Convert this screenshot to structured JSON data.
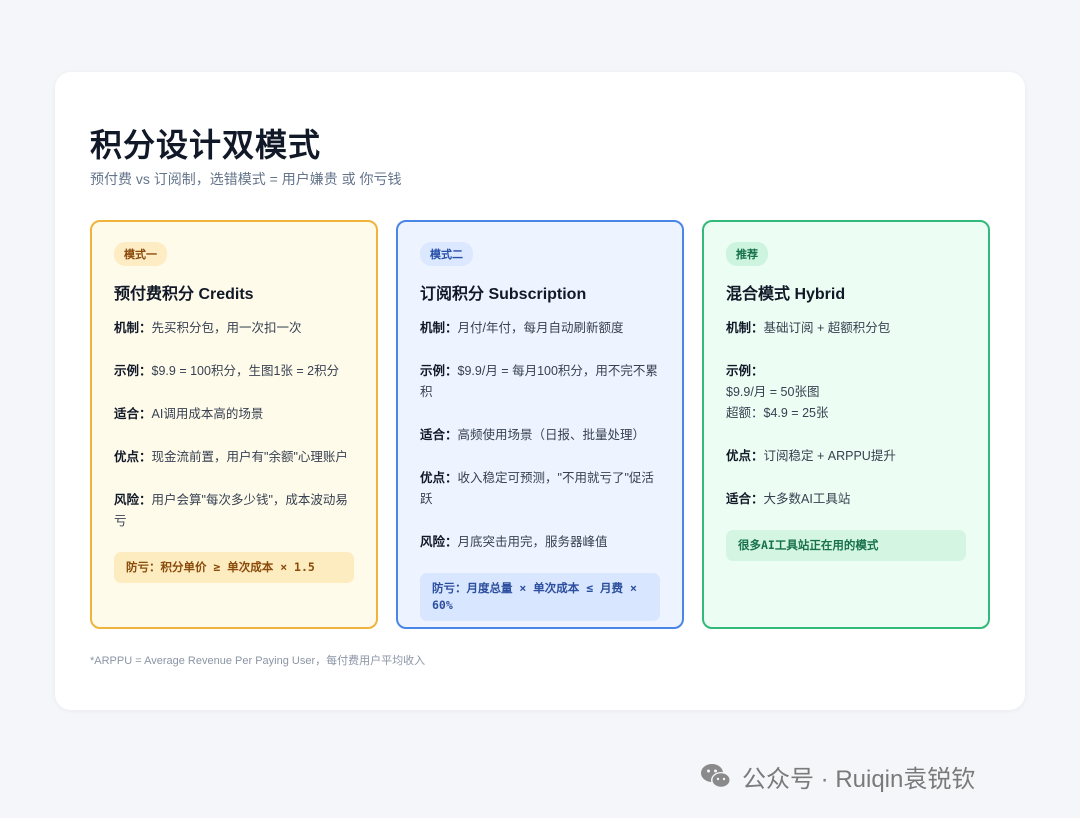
{
  "header": {
    "title": "积分设计双模式",
    "subtitle": "预付费 vs 订阅制，选错模式 = 用户嫌贵 或 你亏钱"
  },
  "columns": [
    {
      "badge": "模式一",
      "title": "预付费积分 Credits",
      "rows": [
        {
          "key": "机制：",
          "val": "先买积分包，用一次扣一次"
        },
        {
          "key": "示例：",
          "val": "$9.9 = 100积分，生图1张 = 2积分"
        },
        {
          "key": "适合：",
          "val": "AI调用成本高的场景"
        },
        {
          "key": "优点：",
          "val": "现金流前置，用户有\"余额\"心理账户"
        },
        {
          "key": "风险：",
          "val": "用户会算\"每次多少钱\"，成本波动易亏"
        }
      ],
      "tip": "防亏：积分单价 ≥ 单次成本 × 1.5"
    },
    {
      "badge": "模式二",
      "title": "订阅积分 Subscription",
      "rows": [
        {
          "key": "机制：",
          "val": "月付/年付，每月自动刷新额度"
        },
        {
          "key": "示例：",
          "val": "$9.9/月 = 每月100积分，用不完不累积"
        },
        {
          "key": "适合：",
          "val": "高频使用场景（日报、批量处理）"
        },
        {
          "key": "优点：",
          "val": "收入稳定可预测，\"不用就亏了\"促活跃"
        },
        {
          "key": "风险：",
          "val": "月底突击用完，服务器峰值"
        }
      ],
      "tip": "防亏：月度总量 × 单次成本 ≤ 月费 × 60%"
    },
    {
      "badge": "推荐",
      "title": "混合模式 Hybrid",
      "rows": [
        {
          "key": "机制：",
          "val": "基础订阅 + 超额积分包"
        },
        {
          "key": "示例：",
          "val": "$9.9/月 = 50张图",
          "val2": "超额：$4.9 = 25张"
        },
        {
          "key": "优点：",
          "val": "订阅稳定 + ARPPU提升"
        },
        {
          "key": "适合：",
          "val": "大多数AI工具站"
        }
      ],
      "tip": "很多AI工具站正在用的模式"
    }
  ],
  "footnote": "*ARPPU = Average Revenue Per Paying User，每付费用户平均收入",
  "watermark": "公众号 · Ruiqin袁锐钦",
  "colors": {
    "mode1_border": "#f0b43c",
    "mode2_border": "#4a86e8",
    "mode3_border": "#33b97a"
  }
}
